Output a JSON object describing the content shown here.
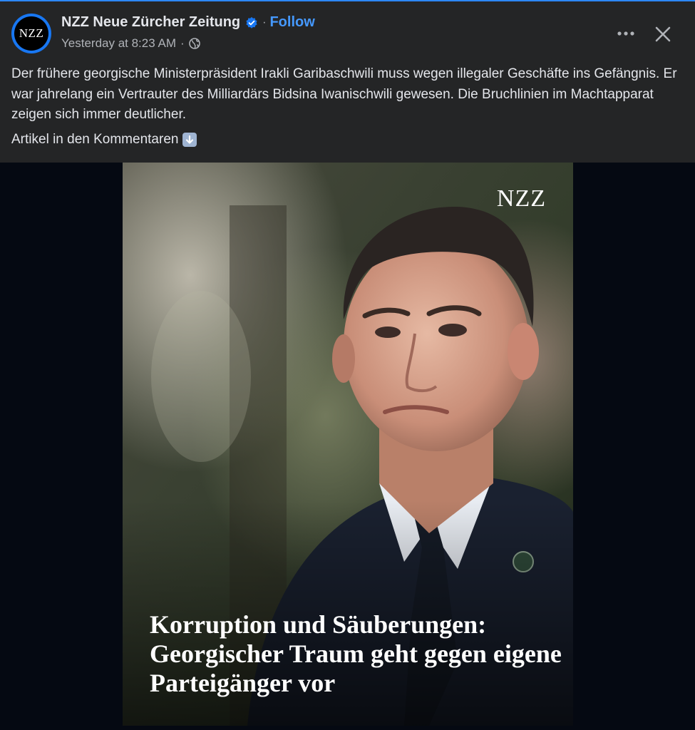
{
  "post": {
    "page_name": "NZZ Neue Zürcher Zeitung",
    "avatar_text": "NZZ",
    "verified_icon": "verified-badge-icon",
    "follow_label": "Follow",
    "timestamp": "Yesterday at 8:23 AM",
    "audience_icon": "globe-icon",
    "body_text": "Der frühere georgische Ministerpräsident Irakli Garibaschwili muss wegen illegaler Geschäfte ins Gefängnis. Er war jahrelang ein Vertrauter des Milliardärs Bidsina Iwanischwili gewesen. Die Bruchlinien im Machtapparat zeigen sich immer deutlicher.",
    "cta_text": "Artikel in den Kommentaren",
    "cta_icon": "down-arrow-emoji-icon"
  },
  "image": {
    "brand": "NZZ",
    "headline": "Korruption und Säuberungen: Georgischer Traum geht gegen eigene Parteigänger vor"
  },
  "colors": {
    "card_bg": "#242526",
    "outer_bg": "#050912",
    "accent": "#4599ff",
    "verified": "#1877f2",
    "secondary_text": "#b0b3b8"
  }
}
